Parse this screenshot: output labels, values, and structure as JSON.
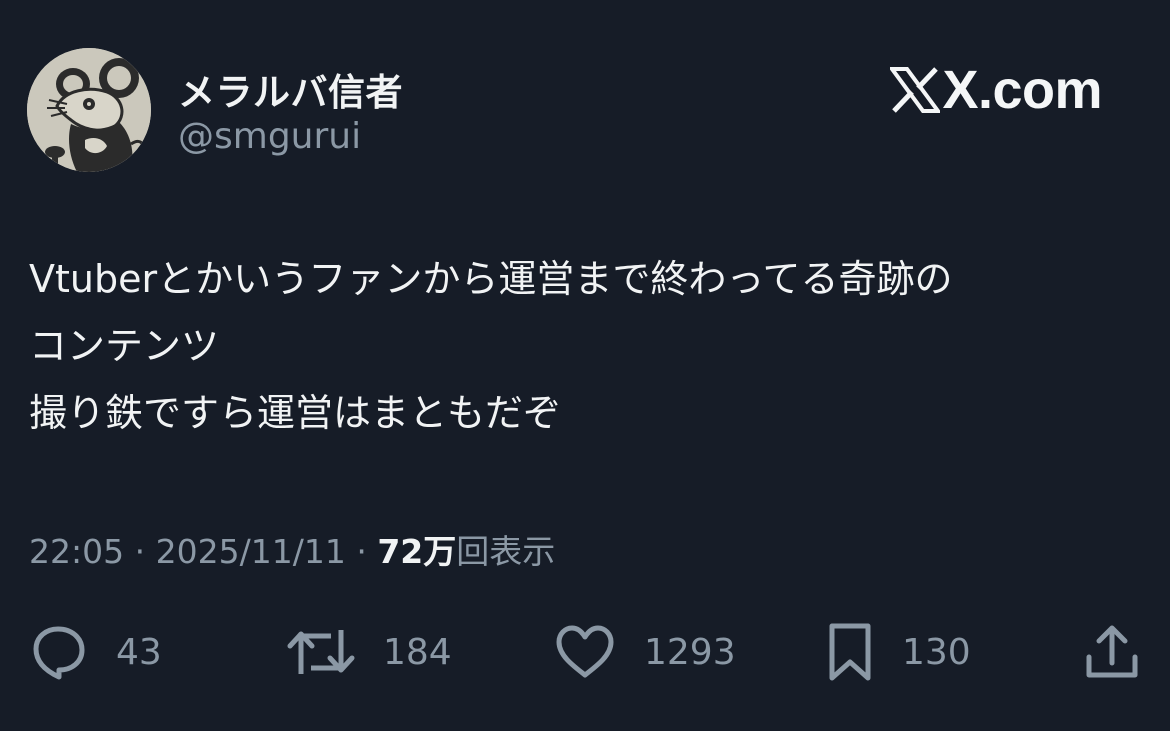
{
  "author": {
    "display_name": "メラルバ信者",
    "handle": "@smgurui"
  },
  "brand": {
    "name": "X.com"
  },
  "tweet": {
    "lines": [
      "Vtuberとかいうファンから運営まで終わってる奇跡の",
      "コンテンツ",
      "撮り鉄ですら運営はまともだぞ"
    ]
  },
  "meta": {
    "time": "22:05",
    "separator": "·",
    "date": "2025/11/11",
    "views_count": "72万",
    "views_label": "回表示"
  },
  "actions": {
    "replies": "43",
    "reposts": "184",
    "likes": "1293",
    "bookmarks": "130"
  },
  "colors": {
    "background": "#161c27",
    "text_primary": "#f1f3f4",
    "text_secondary": "#8b98a5"
  },
  "icons": {
    "reply": "speech-bubble-icon",
    "repost": "repost-arrows-icon",
    "like": "heart-outline-icon",
    "bookmark": "bookmark-icon",
    "share": "share-upload-icon",
    "brand": "x-logo-icon"
  }
}
